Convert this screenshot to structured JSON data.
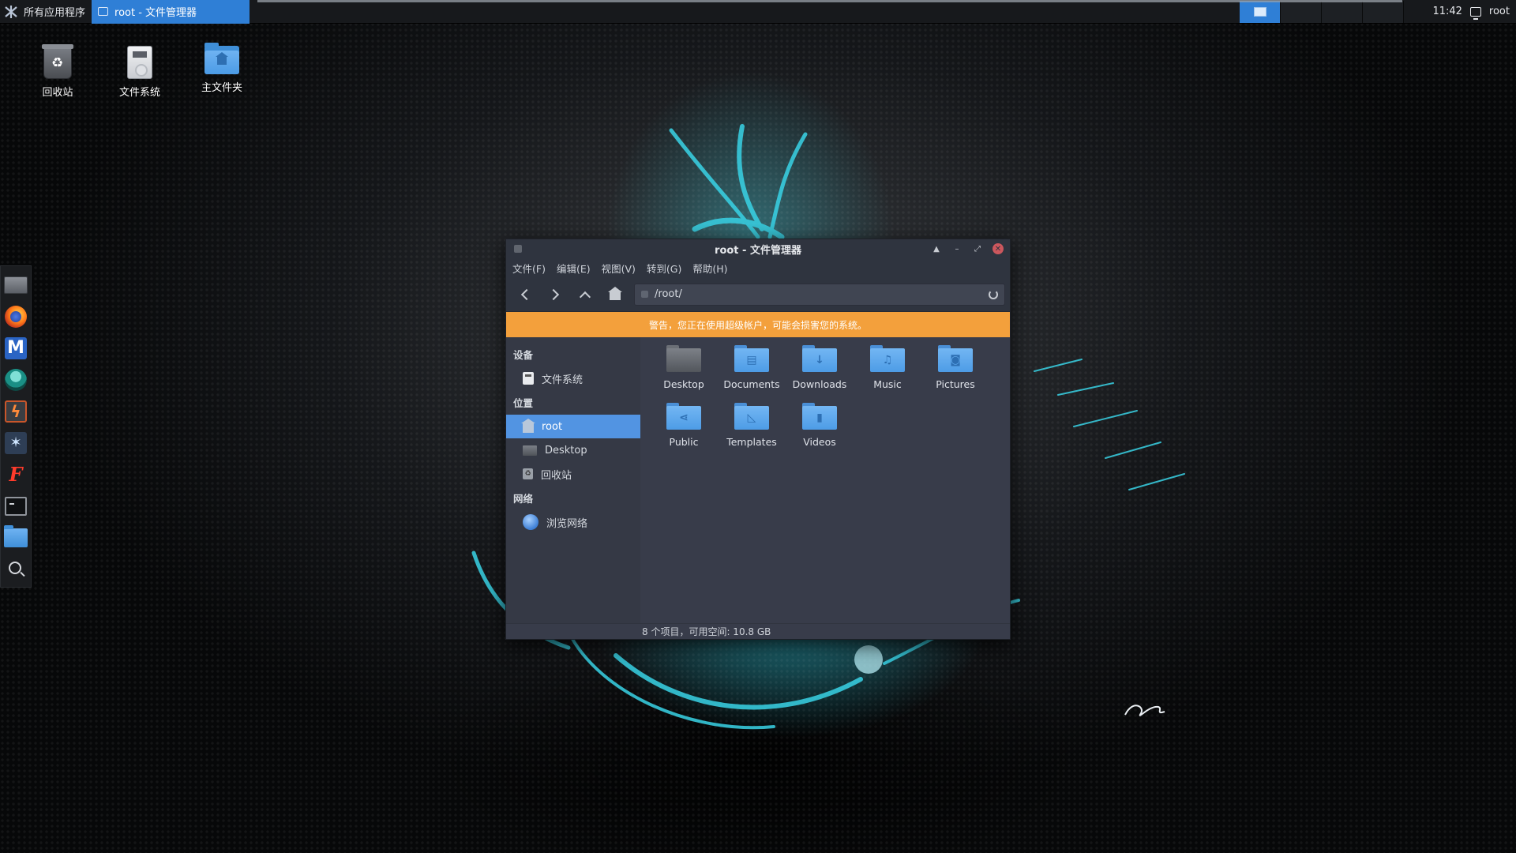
{
  "panel": {
    "apps_menu_label": "所有应用程序",
    "task_title": "root - 文件管理器",
    "clock": "11:42",
    "user": "root",
    "accent": "#2f7fd6"
  },
  "desktop_icons": [
    {
      "label": "回收站",
      "icon": "trash-icon"
    },
    {
      "label": "文件系统",
      "icon": "drive-icon"
    },
    {
      "label": "主文件夹",
      "icon": "home-folder-icon"
    }
  ],
  "dock": [
    "monitor-icon",
    "firefox-icon",
    "m-app-icon",
    "armitage-icon",
    "burp-icon",
    "kali-tool-icon",
    "faraday-icon",
    "terminal-icon",
    "folder-icon",
    "search-icon"
  ],
  "window": {
    "title": "root - 文件管理器",
    "menu": [
      "文件(F)",
      "编辑(E)",
      "视图(V)",
      "转到(G)",
      "帮助(H)"
    ],
    "location": "/root/",
    "warning": "警告，您正在使用超级帐户，可能会损害您的系统。",
    "warning_color": "#f3a03c",
    "sidebar": {
      "devices_header": "设备",
      "devices": [
        {
          "label": "文件系统",
          "icon": "drive-icon"
        }
      ],
      "places_header": "位置",
      "places": [
        {
          "label": "root",
          "icon": "home-icon",
          "selected": true
        },
        {
          "label": "Desktop",
          "icon": "desktop-icon"
        },
        {
          "label": "回收站",
          "icon": "trash-icon"
        }
      ],
      "network_header": "网络",
      "network": [
        {
          "label": "浏览网络",
          "icon": "network-icon"
        }
      ]
    },
    "files": [
      {
        "label": "Desktop",
        "icon": "desktop-folder-icon"
      },
      {
        "label": "Documents",
        "icon": "documents-folder-icon"
      },
      {
        "label": "Downloads",
        "icon": "downloads-folder-icon"
      },
      {
        "label": "Music",
        "icon": "music-folder-icon"
      },
      {
        "label": "Pictures",
        "icon": "pictures-folder-icon"
      },
      {
        "label": "Public",
        "icon": "public-folder-icon"
      },
      {
        "label": "Templates",
        "icon": "templates-folder-icon"
      },
      {
        "label": "Videos",
        "icon": "videos-folder-icon"
      }
    ],
    "status": "8 个项目，可用空间: 10.8 GB",
    "selection_color": "#5294e2"
  }
}
